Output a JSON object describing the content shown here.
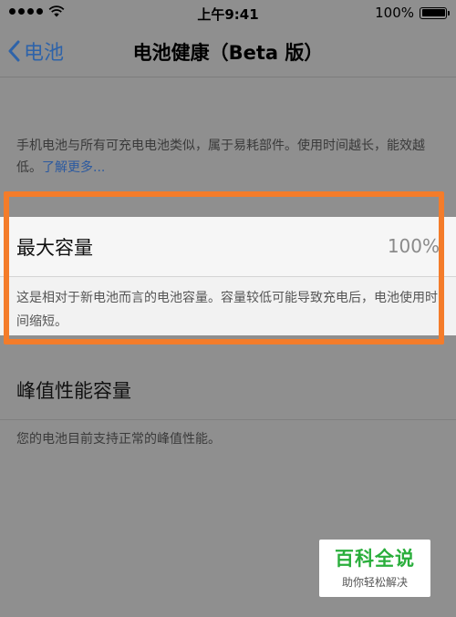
{
  "status_bar": {
    "time": "上午9:41",
    "battery_text": "100%",
    "battery_level": 1.0
  },
  "nav": {
    "back_label": "电池",
    "title": "电池健康（Beta 版）"
  },
  "info": {
    "text": "手机电池与所有可充电电池类似，属于易耗部件。使用时间越长，能效越低。",
    "link": "了解更多..."
  },
  "max_capacity": {
    "label": "最大容量",
    "value": "100%",
    "description": "这是相对于新电池而言的电池容量。容量较低可能导致充电后，电池使用时间缩短。"
  },
  "peak_performance": {
    "label": "峰值性能容量",
    "description": "您的电池目前支持正常的峰值性能。"
  },
  "watermark": {
    "main": "百科全说",
    "sub": "助你轻松解决"
  },
  "colors": {
    "background": "#8f8f8f",
    "highlight": "#f47c2a",
    "link": "#2e63a9",
    "watermark_green": "#2aae3c"
  },
  "icons": [
    "signal-dots-icon",
    "wifi-icon",
    "battery-icon",
    "chevron-left-icon"
  ]
}
